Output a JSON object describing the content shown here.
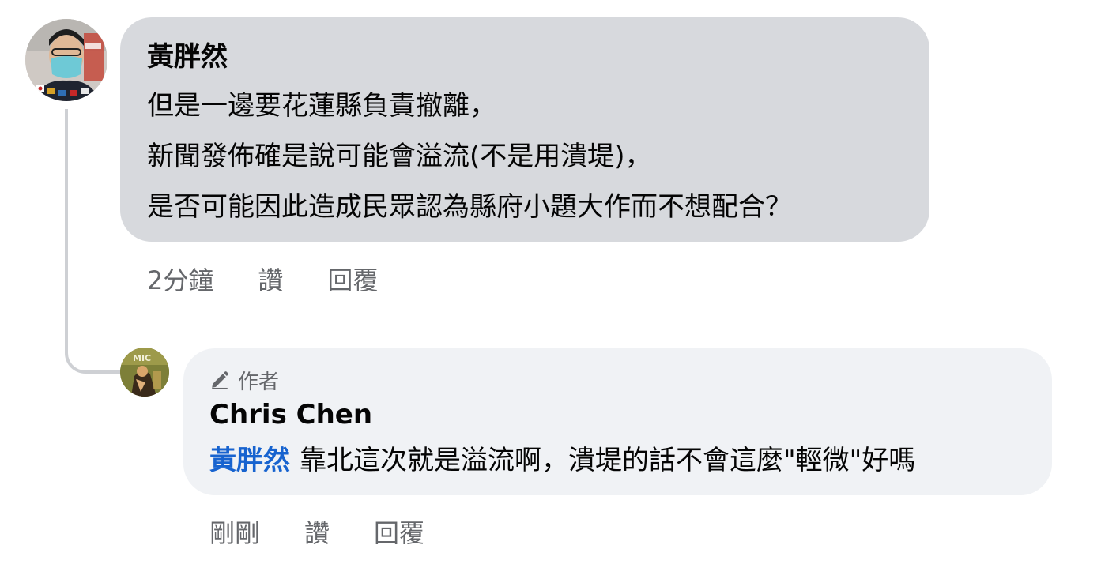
{
  "comments": [
    {
      "author": "黃胖然",
      "lines": [
        "但是一邊要花蓮縣負責撤離，",
        "新聞發佈確是說可能會溢流(不是用潰堤)，",
        "是否可能因此造成民眾認為縣府小題大作而不想配合？"
      ],
      "time": "2分鐘",
      "like_label": "讚",
      "reply_label": "回覆"
    },
    {
      "badge": "作者",
      "author": "Chris Chen",
      "mention": "黃胖然",
      "text": "靠北這次就是溢流啊，潰堤的話不會這麼\"輕微\"好嗎",
      "time": "剛剛",
      "like_label": "讚",
      "reply_label": "回覆"
    }
  ],
  "colors": {
    "bubble_primary": "#d7d9dd",
    "bubble_reply": "#f0f2f5",
    "mention": "#1763cf",
    "meta_text": "#65676b"
  },
  "icons": {
    "author_badge": "pencil-icon"
  }
}
